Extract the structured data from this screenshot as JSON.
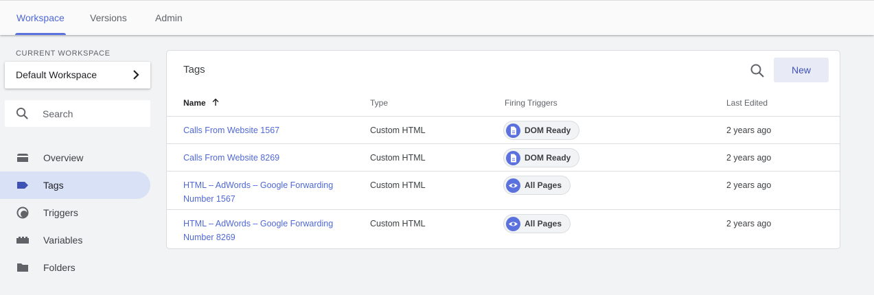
{
  "top_tabs": [
    {
      "label": "Workspace",
      "active": true
    },
    {
      "label": "Versions",
      "active": false
    },
    {
      "label": "Admin",
      "active": false
    }
  ],
  "sidebar": {
    "workspace_label": "CURRENT WORKSPACE",
    "workspace_name": "Default Workspace",
    "search_placeholder": "Search",
    "items": [
      {
        "label": "Overview",
        "icon": "overview-icon",
        "active": false
      },
      {
        "label": "Tags",
        "icon": "tag-icon",
        "active": true
      },
      {
        "label": "Triggers",
        "icon": "trigger-icon",
        "active": false
      },
      {
        "label": "Variables",
        "icon": "variables-icon",
        "active": false
      },
      {
        "label": "Folders",
        "icon": "folder-icon",
        "active": false
      }
    ]
  },
  "tags_card": {
    "title": "Tags",
    "new_button": "New",
    "columns": {
      "name": "Name",
      "type": "Type",
      "triggers": "Firing Triggers",
      "edited": "Last Edited"
    },
    "rows": [
      {
        "name": "Calls From Website 1567",
        "type": "Custom HTML",
        "trigger": "DOM Ready",
        "trigger_icon": "document-icon",
        "edited": "2 years ago"
      },
      {
        "name": "Calls From Website 8269",
        "type": "Custom HTML",
        "trigger": "DOM Ready",
        "trigger_icon": "document-icon",
        "edited": "2 years ago"
      },
      {
        "name": "HTML – AdWords – Google Forwarding Number 1567",
        "type": "Custom HTML",
        "trigger": "All Pages",
        "trigger_icon": "eye-icon",
        "edited": "2 years ago"
      },
      {
        "name": "HTML – AdWords – Google Forwarding Number 8269",
        "type": "Custom HTML",
        "trigger": "All Pages",
        "trigger_icon": "eye-icon",
        "edited": "2 years ago"
      }
    ]
  },
  "colors": {
    "accent": "#4f68d6",
    "active_nav_bg": "#d9e1f7",
    "chip_icon_bg": "#5b72de"
  }
}
